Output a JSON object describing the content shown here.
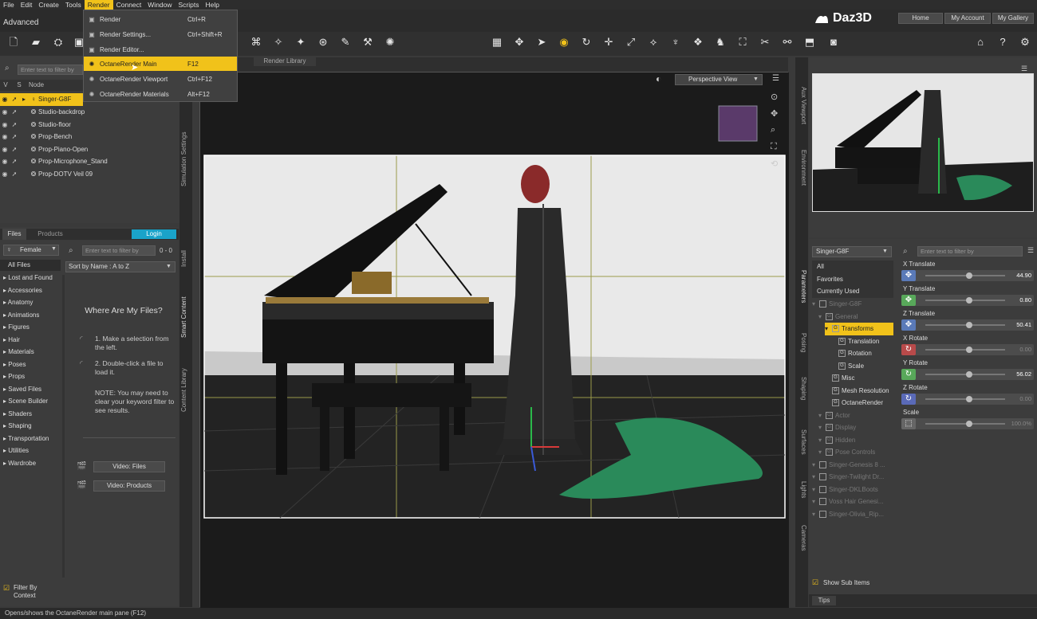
{
  "menubar": [
    "File",
    "Edit",
    "Create",
    "Tools",
    "Render",
    "Connect",
    "Window",
    "Scripts",
    "Help"
  ],
  "workspace": "Advanced",
  "brand": "Daz3D",
  "topnav": [
    "Home",
    "My Account",
    "My Gallery"
  ],
  "render_menu": [
    {
      "label": "Render",
      "shortcut": "Ctrl+R",
      "icon": "render-icon"
    },
    {
      "label": "Render Settings...",
      "shortcut": "Ctrl+Shift+R",
      "icon": "render-settings-icon"
    },
    {
      "label": "Render Editor...",
      "shortcut": "",
      "icon": "render-editor-icon"
    },
    {
      "label": "OctaneRender Main",
      "shortcut": "F12",
      "icon": "octane-icon",
      "highlighted": true
    },
    {
      "label": "OctaneRender Viewport",
      "shortcut": "Ctrl+F12",
      "icon": "octane-icon"
    },
    {
      "label": "OctaneRender Materials",
      "shortcut": "Alt+F12",
      "icon": "octane-icon"
    }
  ],
  "scene": {
    "search_placeholder": "Enter text to filter by",
    "columns": [
      "V",
      "S",
      "Node"
    ],
    "nodes": [
      "Singer-G8F",
      "Studio-backdrop",
      "Studio-floor",
      "Prop-Bench",
      "Prop-Piano-Open",
      "Prop-Microphone_Stand",
      "Prop-DOTV Veil 09"
    ]
  },
  "content": {
    "tabs": [
      "Files",
      "Products"
    ],
    "login": "Login",
    "category": "Female",
    "search_placeholder": "Enter text to filter by",
    "count": "0 - 0",
    "sort": "Sort by Name : A to Z",
    "folders": [
      "All Files",
      "Lost and Found",
      "Accessories",
      "Anatomy",
      "Animations",
      "Figures",
      "Hair",
      "Materials",
      "Poses",
      "Props",
      "Saved Files",
      "Scene Builder",
      "Shaders",
      "Shaping",
      "Transportation",
      "Utilities",
      "Wardrobe"
    ],
    "where_title": "Where Are My Files?",
    "step1": "1. Make a selection from the left.",
    "step2": "2. Double-click a file to load it.",
    "note": "NOTE: You may need to clear your keyword filter to see results.",
    "video_files": "Video: Files",
    "video_products": "Video: Products",
    "filter_context": "Filter By Context"
  },
  "left_vtabs": [
    "Simulation Settings",
    "Install",
    "Smart Content",
    "Content Library"
  ],
  "viewport": {
    "tab": "Render Library",
    "view": "Perspective View"
  },
  "right_vtabs_top": [
    "Aux Viewport",
    "Environment"
  ],
  "right_vtabs_bottom": [
    "Parameters",
    "Posing",
    "Shaping",
    "Surfaces",
    "Lights",
    "Cameras"
  ],
  "params": {
    "node": "Singer-G8F",
    "search_placeholder": "Enter text to filter by",
    "filters": [
      "All",
      "Favorites",
      "Currently Used"
    ],
    "tree": [
      {
        "label": "Singer-G8F",
        "indent": 0,
        "dim": true
      },
      {
        "label": "General",
        "indent": 1,
        "dim": true
      },
      {
        "label": "Transforms",
        "indent": 2,
        "selected": true
      },
      {
        "label": "Translation",
        "indent": 3
      },
      {
        "label": "Rotation",
        "indent": 3
      },
      {
        "label": "Scale",
        "indent": 3
      },
      {
        "label": "Misc",
        "indent": 2
      },
      {
        "label": "Mesh Resolution",
        "indent": 2
      },
      {
        "label": "OctaneRender",
        "indent": 2
      },
      {
        "label": "Actor",
        "indent": 1,
        "dim": true
      },
      {
        "label": "Display",
        "indent": 1,
        "dim": true
      },
      {
        "label": "Hidden",
        "indent": 1,
        "dim": true
      },
      {
        "label": "Pose Controls",
        "indent": 1,
        "dim": true
      },
      {
        "label": "Singer-Genesis 8 ...",
        "indent": 0,
        "dim": true
      },
      {
        "label": "Singer-Twilight Dr...",
        "indent": 0,
        "dim": true
      },
      {
        "label": "Singer-DKLBoots",
        "indent": 0,
        "dim": true
      },
      {
        "label": "Voss Hair Genesi...",
        "indent": 0,
        "dim": true
      },
      {
        "label": "Singer-Olivia_Rip...",
        "indent": 0,
        "dim": true
      }
    ],
    "show_sub": "Show Sub Items",
    "sliders": [
      {
        "label": "X Translate",
        "value": "44.90",
        "fraction": 0.55,
        "color": "#5a7ab8",
        "icon": "move-icon",
        "dim": false
      },
      {
        "label": "Y Translate",
        "value": "0.80",
        "fraction": 0.55,
        "color": "#58a85a",
        "icon": "move-icon",
        "dim": false
      },
      {
        "label": "Z Translate",
        "value": "50.41",
        "fraction": 0.55,
        "color": "#5a7ab8",
        "icon": "move-icon",
        "dim": false
      },
      {
        "label": "X Rotate",
        "value": "0.00",
        "fraction": 0.55,
        "color": "#b84a4a",
        "icon": "rotate-icon",
        "dim": true
      },
      {
        "label": "Y Rotate",
        "value": "56.02",
        "fraction": 0.55,
        "color": "#58a85a",
        "icon": "rotate-icon",
        "dim": false
      },
      {
        "label": "Z Rotate",
        "value": "0.00",
        "fraction": 0.55,
        "color": "#5a6ab8",
        "icon": "rotate-icon",
        "dim": true
      },
      {
        "label": "Scale",
        "value": "100.0%",
        "fraction": 0.55,
        "color": "#666666",
        "icon": "scale-icon",
        "dim": true
      }
    ],
    "tips": "Tips"
  },
  "status": "Opens/shows the OctaneRender main pane (F12)"
}
